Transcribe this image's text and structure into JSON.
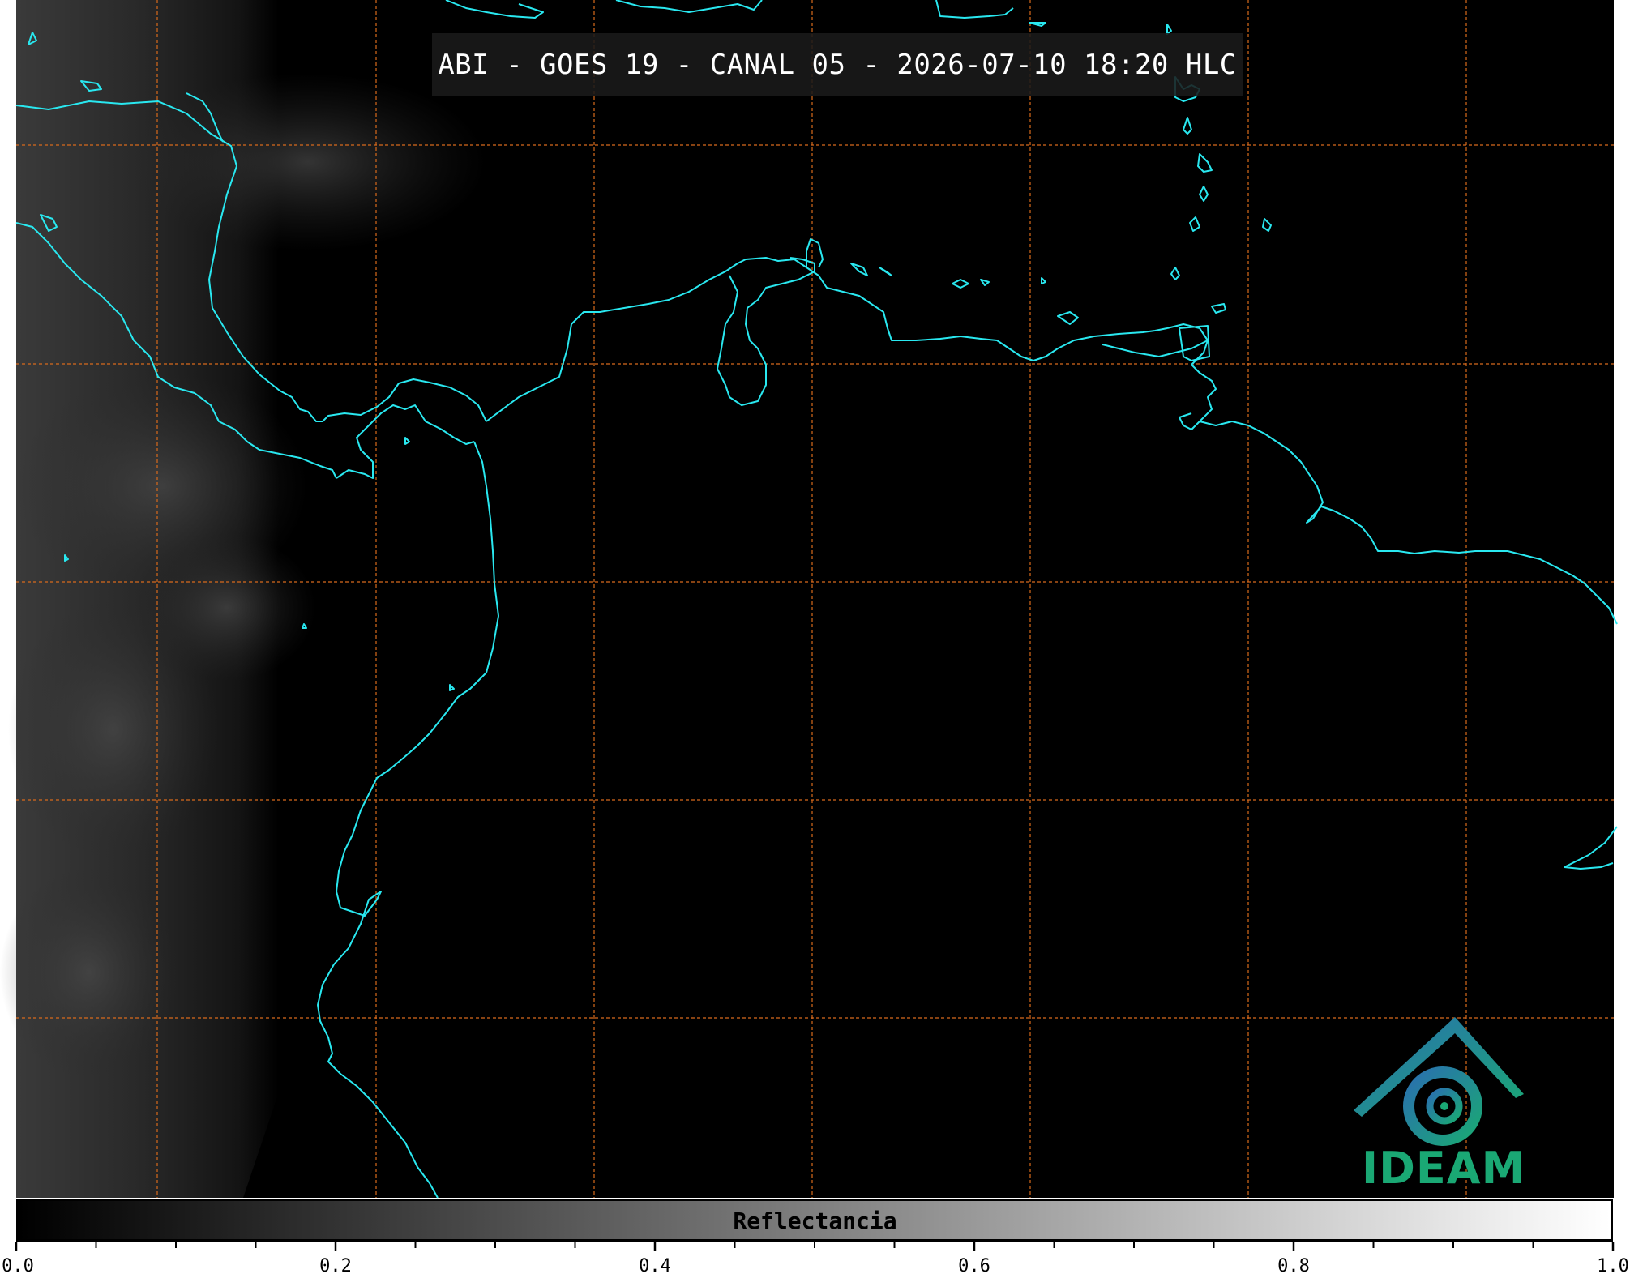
{
  "title": "ABI - GOES 19 - CANAL 05 - 2026-07-10 18:20 HLC",
  "colorbar": {
    "label": "Reflectancia",
    "range": [
      0.0,
      1.0
    ],
    "ticks": [
      "0.0",
      "0.2",
      "0.4",
      "0.6",
      "0.8",
      "1.0"
    ],
    "gradient": [
      "#000000",
      "#ffffff"
    ]
  },
  "logo": {
    "text": "IDEAM"
  },
  "colors": {
    "coastline": "#29e8f0",
    "gridlines": "#d86a1c",
    "background": "#000000",
    "logo_primary": "#1aa874",
    "logo_secondary": "#2a6fb0"
  },
  "map": {
    "channel": "CANAL 05",
    "satellite": "GOES 19",
    "instrument": "ABI",
    "grid": true
  }
}
